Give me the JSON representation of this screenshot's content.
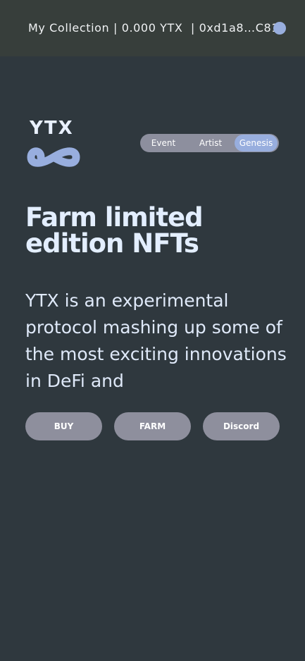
{
  "header": {
    "collection_label": "My Collection",
    "balance": "0.000 YTX",
    "address": "0xd1a8…C81e",
    "separator": "|"
  },
  "logo": {
    "text": "YTX",
    "icon": "infinity-icon",
    "color": "#98aede"
  },
  "toggle": {
    "options": [
      "Event",
      "Artist",
      "Genesis"
    ],
    "selected": "Genesis"
  },
  "hero": {
    "title": "Farm limited edition NFTs",
    "description": "YTX is an experimental protocol mashing up some of the most exciting innovations in DeFi and"
  },
  "actions": {
    "buy_label": "BUY",
    "farm_label": "FARM",
    "discord_label": "Discord"
  },
  "colors": {
    "background": "#2f383e",
    "topbar": "#373e3b",
    "accent": "#98aede",
    "button": "#8e8f9d"
  }
}
